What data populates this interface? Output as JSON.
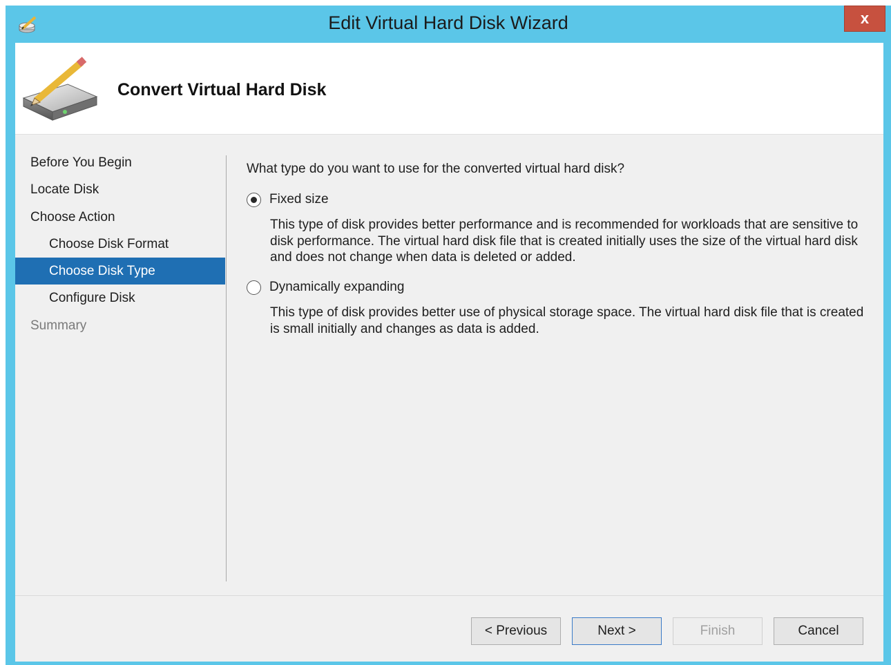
{
  "window": {
    "title": "Edit Virtual Hard Disk Wizard",
    "close_label": "x",
    "app_icon": "edit-disk-icon"
  },
  "header": {
    "title": "Convert Virtual Hard Disk",
    "icon": "hard-disk-pencil-icon"
  },
  "nav": {
    "items": [
      {
        "label": "Before You Begin",
        "level": 0,
        "state": "normal"
      },
      {
        "label": "Locate Disk",
        "level": 0,
        "state": "normal"
      },
      {
        "label": "Choose Action",
        "level": 0,
        "state": "normal"
      },
      {
        "label": "Choose Disk Format",
        "level": 1,
        "state": "normal"
      },
      {
        "label": "Choose Disk Type",
        "level": 1,
        "state": "selected"
      },
      {
        "label": "Configure Disk",
        "level": 1,
        "state": "normal"
      },
      {
        "label": "Summary",
        "level": 0,
        "state": "disabled"
      }
    ]
  },
  "main": {
    "question": "What type do you want to use for the converted virtual hard disk?",
    "options": [
      {
        "label": "Fixed size",
        "checked": true,
        "description": "This type of disk provides better performance and is recommended for workloads that are sensitive to disk performance. The virtual hard disk file that is created initially uses the size of the virtual hard disk and does not change when data is deleted or added."
      },
      {
        "label": "Dynamically expanding",
        "checked": false,
        "description": "This type of disk provides better use of physical storage space. The virtual hard disk file that is created is small initially and changes as data is added."
      }
    ]
  },
  "footer": {
    "previous_label": "< Previous",
    "next_label": "Next >",
    "finish_label": "Finish",
    "cancel_label": "Cancel"
  },
  "colors": {
    "frame": "#5bc6e8",
    "selection": "#1f6fb3",
    "close": "#c7513f"
  }
}
